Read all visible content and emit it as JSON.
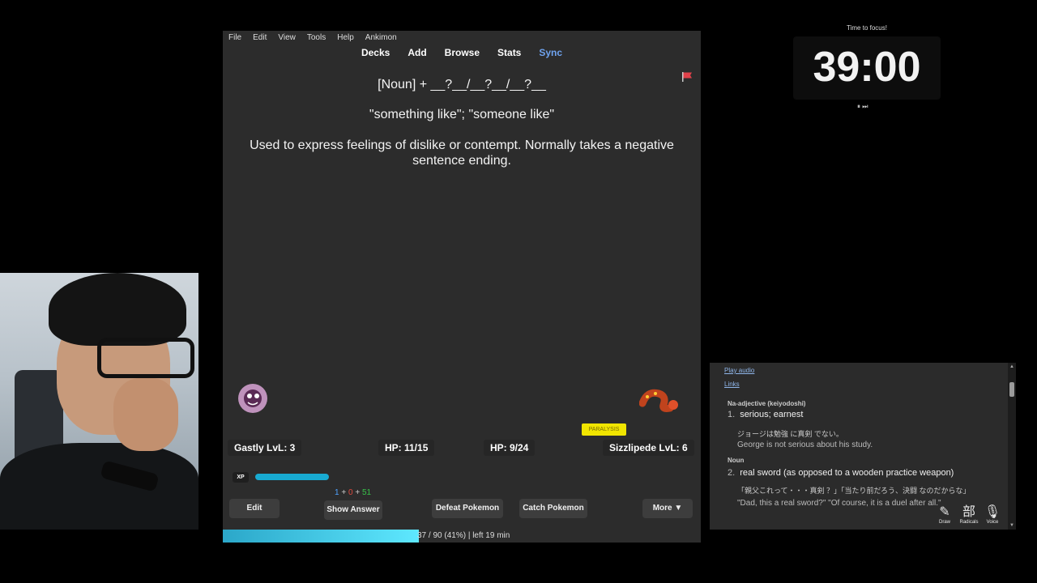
{
  "menu": [
    "File",
    "Edit",
    "View",
    "Tools",
    "Help",
    "Ankimon"
  ],
  "toolbar": [
    "Decks",
    "Add",
    "Browse",
    "Stats",
    "Sync"
  ],
  "card": {
    "pattern": "[Noun] + __?__/__?__/__?__",
    "meaning": "\"something like\"; \"someone like\"",
    "usage": "Used to express feelings of dislike or contempt. Normally takes a negative sentence ending."
  },
  "battle": {
    "player_name": "Gastly LvL: 3",
    "player_hp": "HP: 11/15",
    "enemy_hp": "HP: 9/24",
    "enemy_name": "Sizzlipede LvL: 6",
    "status": "PARALYSIS",
    "xp_label": "XP",
    "xp_fraction": 0.55
  },
  "counts": {
    "new": "1",
    "learn": "0",
    "review": "51",
    "plus": "+"
  },
  "buttons": {
    "edit": "Edit",
    "show_answer": "Show Answer",
    "defeat": "Defeat Pokemon",
    "catch": "Catch Pokemon",
    "more": "More ▼"
  },
  "progress": {
    "text": "37 / 90 (41%) | left 19 min",
    "fraction": 0.41
  },
  "timer": {
    "title": "Time to focus!",
    "value": "39:00",
    "controls": "⏸ ⏭"
  },
  "dictionary": {
    "play_audio": "Play audio",
    "links": "Links",
    "pos1": "Na-adjective (keiyodoshi)",
    "def1_num": "1.",
    "def1": "serious; earnest",
    "ex1_jp": "ジョージは勉強 に真剣 でない。",
    "ex1_en": "George is not serious about his study.",
    "pos2": "Noun",
    "def2_num": "2.",
    "def2": "real sword (as opposed to a wooden practice weapon)",
    "ex2_jp": "「親父これって・・・真剣 ？」「当たり前だろう、決闘 なのだからな」",
    "ex2_en": "\"Dad, this a real sword?\" \"Of course, it is a duel after all.\"",
    "tools": [
      {
        "glyph": "✎",
        "label": "Draw"
      },
      {
        "glyph": "部",
        "label": "Radicals"
      },
      {
        "glyph": "🎙",
        "label": "Voice"
      }
    ]
  },
  "colors": {
    "sync": "#6fa3ef",
    "status": "#f1e500",
    "progress": "#5ee8ff",
    "xp": "#18aad1"
  }
}
